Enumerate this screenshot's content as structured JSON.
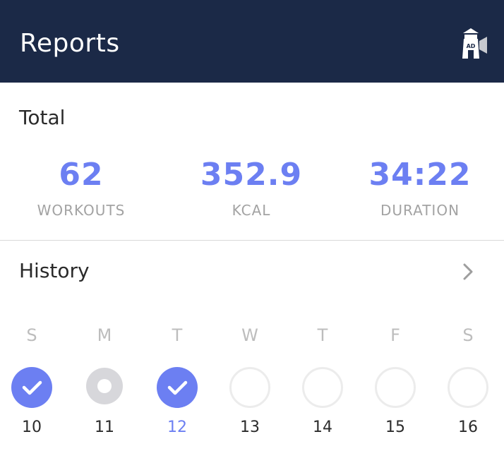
{
  "header": {
    "title": "Reports",
    "ad_icon": "ad-lighthouse-icon"
  },
  "total": {
    "title": "Total",
    "stats": [
      {
        "value": "62",
        "label": "WORKOUTS"
      },
      {
        "value": "352.9",
        "label": "KCAL"
      },
      {
        "value": "34:22",
        "label": "DURATION"
      }
    ]
  },
  "history": {
    "title": "History",
    "chevron_icon": "chevron-right-icon",
    "days": [
      {
        "letter": "S",
        "date": "10",
        "status": "done"
      },
      {
        "letter": "M",
        "date": "11",
        "status": "partial"
      },
      {
        "letter": "T",
        "date": "12",
        "status": "done",
        "today": true
      },
      {
        "letter": "W",
        "date": "13",
        "status": "empty"
      },
      {
        "letter": "T",
        "date": "14",
        "status": "empty"
      },
      {
        "letter": "F",
        "date": "15",
        "status": "empty"
      },
      {
        "letter": "S",
        "date": "16",
        "status": "empty"
      }
    ]
  },
  "colors": {
    "header_bg": "#1b2947",
    "accent": "#6c7ff2",
    "partial": "#d7d7db",
    "empty_ring": "#ececec"
  }
}
